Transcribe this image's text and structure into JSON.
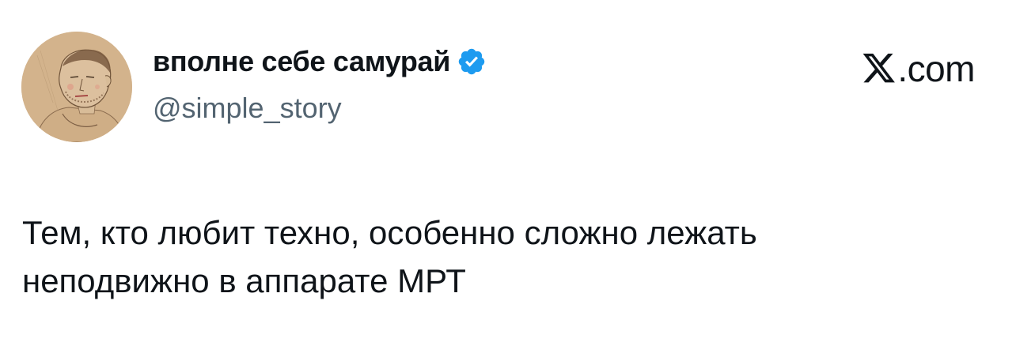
{
  "tweet": {
    "author": {
      "display_name": "вполне себе самурай",
      "handle": "@simple_story",
      "verified_icon": "verified-badge-icon",
      "avatar_icon": "avatar"
    },
    "source": {
      "logo_icon": "x-logo-icon",
      "domain": ".com"
    },
    "text": "Тем, кто любит техно, особенно сложно лежать\nнеподвижно в аппарате МРТ"
  },
  "colors": {
    "text": "#0f1419",
    "secondary_text": "#536471",
    "verified_blue": "#1d9bf0",
    "background": "#ffffff"
  }
}
